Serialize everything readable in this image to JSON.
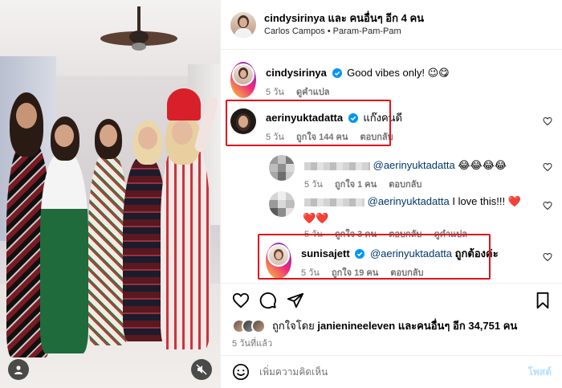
{
  "header": {
    "username": "cindysirinya",
    "and_others": "และ คนอื่นๆ อีก 4 คน",
    "location": "Carlos Campos",
    "dot": "•",
    "audio": "Param-Pam-Pam"
  },
  "caption": {
    "username": "cindysirinya",
    "text": "Good vibes only! 😉😋",
    "time": "5 วัน",
    "translate": "ดูคำแปล"
  },
  "comments": [
    {
      "username": "aerinyuktadatta",
      "text": "แก๊งคนดี",
      "time": "5 วัน",
      "likes": "ถูกใจ 144 คน",
      "reply": "ตอบกลับ"
    },
    {
      "username": "",
      "mention": "@aerinyuktadatta",
      "text": "😂😂😂😂",
      "time": "5 วัน",
      "likes": "ถูกใจ 1 คน",
      "reply": "ตอบกลับ"
    },
    {
      "username": "",
      "mention": "@aerinyuktadatta",
      "text": "I love this!!! ❤️",
      "text2": "❤️❤️",
      "time": "5 วัน",
      "likes": "ถูกใจ 3 คน",
      "reply": "ตอบกลับ",
      "translate": "ดูคำแปล"
    },
    {
      "username": "sunisajett",
      "mention": "@aerinyuktadatta",
      "text": "ถูกต้องค่ะ",
      "time": "5 วัน",
      "likes": "ถูกใจ 19 คน",
      "reply": "ตอบกลับ"
    }
  ],
  "likes": {
    "prefix": "ถูกใจโดย",
    "user": "janienineeleven",
    "middle": "และคนอื่นๆ อีก",
    "count": "34,751",
    "suffix": "คน"
  },
  "posted_ago": "5 วันที่แล้ว",
  "comment_box": {
    "placeholder": "เพิ่มความคิดเห็น",
    "post_label": "โพสต์"
  },
  "colors": {
    "highlight": "#e1141c",
    "verified": "#0095f6",
    "mention": "#00376b",
    "heart_red": "#ff3040",
    "post_disabled": "#b2dffc"
  }
}
